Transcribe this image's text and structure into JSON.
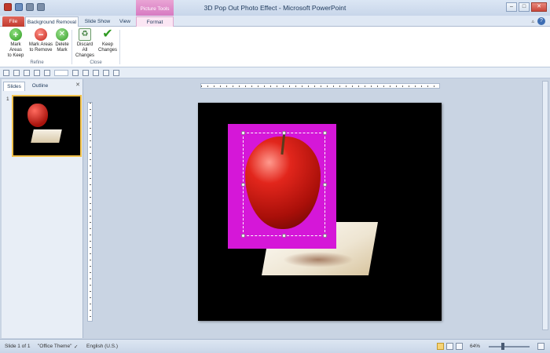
{
  "window": {
    "title": "3D Pop Out Photo Effect - Microsoft PowerPoint",
    "context_tab_title": "Picture Tools"
  },
  "tabs": {
    "file": "File",
    "background_removal": "Background Removal",
    "slide_show": "Slide Show",
    "view": "View",
    "format": "Format"
  },
  "ribbon": {
    "mark_keep": [
      "Mark Areas",
      "to Keep"
    ],
    "mark_remove": [
      "Mark Areas",
      "to Remove"
    ],
    "delete_mark": [
      "Delete",
      "Mark"
    ],
    "discard": [
      "Discard All",
      "Changes"
    ],
    "keep": [
      "Keep",
      "Changes"
    ],
    "group_refine": "Refine",
    "group_close": "Close"
  },
  "slide_pane": {
    "tab_slides": "Slides",
    "tab_outline": "Outline",
    "slide_number": "1"
  },
  "status": {
    "slide_info": "Slide 1 of 1",
    "theme": "\"Office Theme\"",
    "language": "English (U.S.)",
    "zoom": "64%"
  },
  "colors": {
    "removal_overlay": "#d517d8",
    "file_tab": "#c13b2f",
    "picture_tools": "#d77ac2"
  },
  "icons": [
    "save-icon",
    "undo-icon",
    "redo-icon",
    "plus-icon",
    "minus-icon",
    "eraser-icon",
    "discard-icon",
    "check-icon",
    "help-icon"
  ]
}
